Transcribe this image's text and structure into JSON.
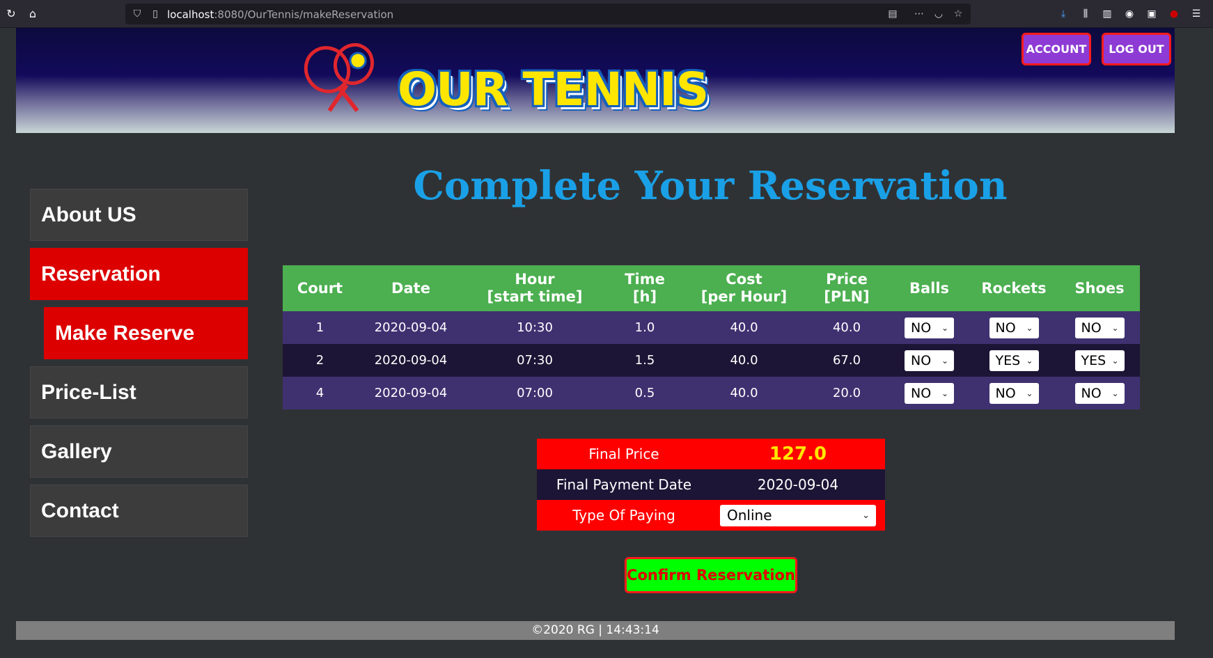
{
  "browser": {
    "url_host": "localhost",
    "url_rest": ":8080/OurTennis/makeReservation"
  },
  "header": {
    "logo_text": "OUR TENNIS",
    "account_label": "ACCOUNT",
    "logout_label": "LOG OUT"
  },
  "sidebar": {
    "items": [
      {
        "label": "About US"
      },
      {
        "label": "Reservation"
      },
      {
        "label": "Make Reserve"
      },
      {
        "label": "Price-List"
      },
      {
        "label": "Gallery"
      },
      {
        "label": "Contact"
      }
    ]
  },
  "main": {
    "title": "Complete Your Reservation"
  },
  "table": {
    "headers": [
      {
        "l1": "Court",
        "l2": ""
      },
      {
        "l1": "Date",
        "l2": ""
      },
      {
        "l1": "Hour",
        "l2": "[start time]"
      },
      {
        "l1": "Time",
        "l2": "[h]"
      },
      {
        "l1": "Cost",
        "l2": "[per Hour]"
      },
      {
        "l1": "Price",
        "l2": "[PLN]"
      },
      {
        "l1": "Balls",
        "l2": ""
      },
      {
        "l1": "Rockets",
        "l2": ""
      },
      {
        "l1": "Shoes",
        "l2": ""
      }
    ],
    "rows": [
      {
        "court": "1",
        "date": "2020-09-04",
        "hour": "10:30",
        "time": "1.0",
        "cost": "40.0",
        "price": "40.0",
        "balls": "NO",
        "rockets": "NO",
        "shoes": "NO"
      },
      {
        "court": "2",
        "date": "2020-09-04",
        "hour": "07:30",
        "time": "1.5",
        "cost": "40.0",
        "price": "67.0",
        "balls": "NO",
        "rockets": "YES",
        "shoes": "YES"
      },
      {
        "court": "4",
        "date": "2020-09-04",
        "hour": "07:00",
        "time": "0.5",
        "cost": "40.0",
        "price": "20.0",
        "balls": "NO",
        "rockets": "NO",
        "shoes": "NO"
      }
    ]
  },
  "summary": {
    "final_price_label": "Final Price",
    "final_price_value": "127.0",
    "payment_date_label": "Final Payment Date",
    "payment_date_value": "2020-09-04",
    "paying_type_label": "Type Of Paying",
    "paying_type_value": "Online"
  },
  "confirm_label": "Confirm Reservation",
  "footer": {
    "text": "©2020 RG | 14:43:14"
  },
  "colors": {
    "accent_red": "#dc0000",
    "title_blue": "#1aa0e6",
    "table_header_green": "#4caf50",
    "button_purple": "#8d3bd4",
    "confirm_green": "#00ff00"
  }
}
